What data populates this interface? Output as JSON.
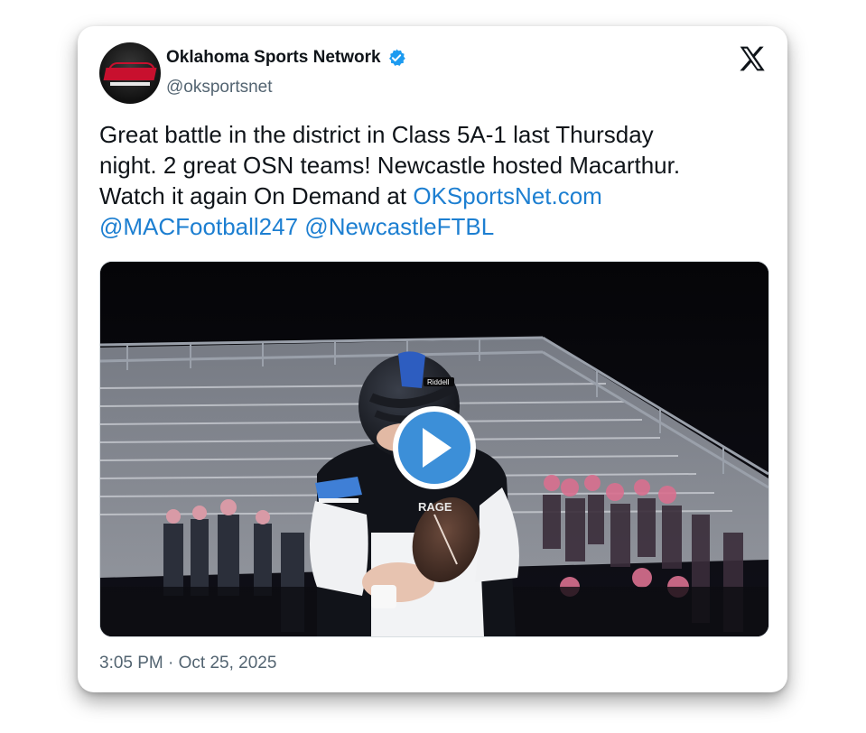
{
  "tweet": {
    "author": {
      "display_name": "Oklahoma Sports Network",
      "handle": "@oksportsnet",
      "verified": true,
      "avatar_icon": "osn-logo-avatar"
    },
    "platform_icon": "x-logo-icon",
    "text": {
      "line1": "Great battle in the district in Class 5A-1 last Thursday",
      "line2": "night. 2 great OSN teams! Newcastle hosted Macarthur.",
      "line3_prefix": "Watch it again On Demand at ",
      "link_url": "OKSportsNet.com",
      "mention1": "@MACFootball247",
      "mention2": "@NewcastleFTBL"
    },
    "media": {
      "type": "video",
      "helmet_brand": "Riddell",
      "jersey_text": "RAGE",
      "play_icon": "play-icon"
    },
    "timestamp": "3:05 PM · Oct 25, 2025"
  },
  "colors": {
    "link": "#1d7fd1",
    "verified": "#1d9bf0",
    "play_button": "#3c8fd8",
    "text": "#0f1419",
    "muted": "#536471"
  }
}
